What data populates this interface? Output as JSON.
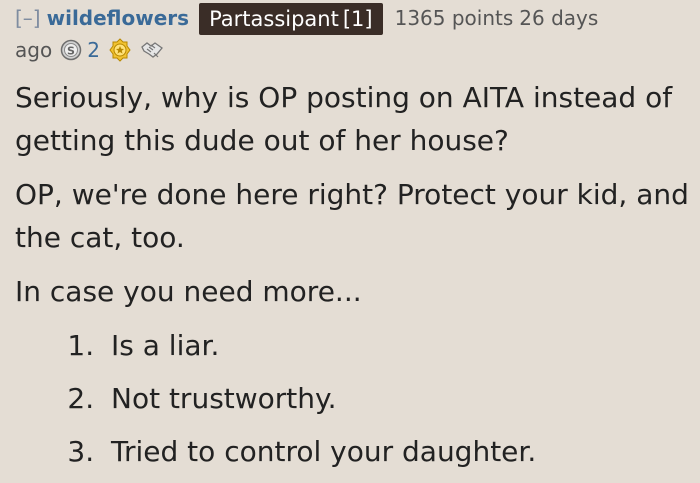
{
  "comment": {
    "collapse_label": "[–]",
    "author": "wildeflowers",
    "flair_text": "Partassipant",
    "flair_count": "[1]",
    "score": "1365 points",
    "age_part1": "26 days",
    "age_part2": "ago",
    "awards": [
      {
        "icon": "silver-award-icon",
        "count": "2"
      },
      {
        "icon": "gold-award-icon",
        "count": ""
      },
      {
        "icon": "handshake-award-icon",
        "count": ""
      }
    ],
    "paragraphs": [
      "Seriously, why is OP posting on AITA instead of getting this dude out of her house?",
      "OP, we're done here right? Protect your kid, and the cat, too.",
      "In case you need more..."
    ],
    "list_items": [
      "Is a liar.",
      "Not trustworthy.",
      "Tried to control your daughter."
    ]
  },
  "colors": {
    "background": "#e4ddd4",
    "author": "#3a6a98",
    "flair_bg": "#3a2d27",
    "text": "#222222",
    "meta": "#555555"
  }
}
